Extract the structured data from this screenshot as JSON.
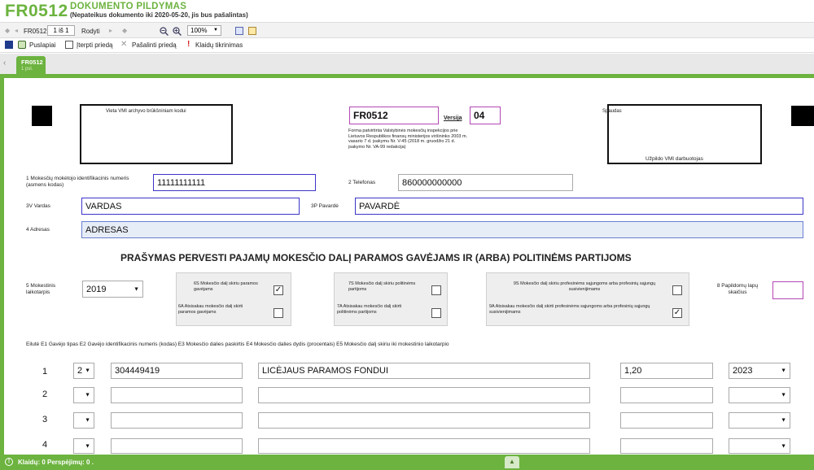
{
  "header": {
    "form_code": "FR0512",
    "title": "DOKUMENTO PILDYMAS",
    "subtitle": "(Nepateikus dokumento iki 2020-05-20, jis bus pašalintas)"
  },
  "toolbar": {
    "form_code": "FR0512",
    "page_indicator": "1 iš 1",
    "show_label": "Rodyti",
    "zoom": "100%"
  },
  "actions": {
    "pages": "Puslapiai",
    "insert_attachment": "Įterpti priedą",
    "remove_attachment": "Pašalinti priedą",
    "check_errors": "Klaidų tikrinimas"
  },
  "tab": {
    "code": "FR0512",
    "page": "1 psl."
  },
  "form": {
    "archive_label": "Vieta VMI archyvo brūkšniniam kodui",
    "form_code": "FR0512",
    "version_label": "Versija",
    "version": "04",
    "approval_text": "Forma patvirtinta Valstybinės mokesčių inspekcijos prie Lietuvos Respublikos finansų ministerijos viršininko 2003 m. vasario 7 d. įsakymu Nr. V-45 (2018 m. gruodžio 21 d. įsakymo Nr. VA-99 redakcija)",
    "stamp_label": "Spaudas",
    "vmi_label": "Užpildo VMI darbuotojas",
    "taxpayer_id_label": "1 Mokesčių mokėtojo identifikacinis numeris (asmens kodas)",
    "taxpayer_id": "11111111111",
    "phone_label": "2 Telefonas",
    "phone": "860000000000",
    "first_name_label": "3V Vardas",
    "first_name": "VARDAS",
    "last_name_label": "3P Pavardė",
    "last_name": "PAVARDĖ",
    "address_label": "4 Adresas",
    "address": "ADRESAS",
    "section_title": "PRAŠYMAS PERVESTI PAJAMŲ MOKESČIO DALĮ PARAMOS GAVĖJAMS IR (ARBA) POLITINĖMS PARTIJOMS",
    "tax_period_label": "5 Mokestinis laikotarpis",
    "tax_period": "2019",
    "opt6s": "6S Mokesčio dalį skiriu paramos gavėjams",
    "opt6a": "6A Atsisakau mokesčio dalį skirti paramos gavėjams",
    "opt7s": "7S Mokesčio dalį skiriu politinėms partijoms",
    "opt7a": "7A Atsisakau mokesčio dalį skirti politinėms partijoms",
    "opt9s": "9S Mokesčio dalį skiriu profesinėms sąjungoms arba profesinių sąjungų susivienijimams",
    "opt9a": "9A Atsisakau mokesčio dalį skirti profesinėms sąjungoms arba profesinių sąjungų susivienijimams",
    "extra_pages_label": "8 Papildomų lapų skaičius",
    "check_mark": "✓",
    "table_header": "Eilutė E1 Gavėjo tipas E2 Gavėjo identifikacinis numeris (kodas) E3 Mokesčio dalies paskirtis E4 Mokesčio dalies dydis (procentais) E5 Mokesčio dalį skiriu iki mokestinio laikotarpio",
    "rows": [
      {
        "num": "1",
        "type": "2",
        "code": "304449419",
        "purpose": "LICĖJAUS PARAMOS FONDUI",
        "percent": "1,20",
        "year": "2023"
      },
      {
        "num": "2",
        "type": "",
        "code": "",
        "purpose": "",
        "percent": "",
        "year": ""
      },
      {
        "num": "3",
        "type": "",
        "code": "",
        "purpose": "",
        "percent": "",
        "year": ""
      },
      {
        "num": "4",
        "type": "",
        "code": "",
        "purpose": "",
        "percent": "",
        "year": ""
      }
    ]
  },
  "status": {
    "text": "Klaidų: 0 Perspėjimų: 0 ."
  },
  "colors": {
    "accent": "#6cb33f",
    "field_border": "#3b35c9",
    "field_border_alt": "#b347b3"
  }
}
